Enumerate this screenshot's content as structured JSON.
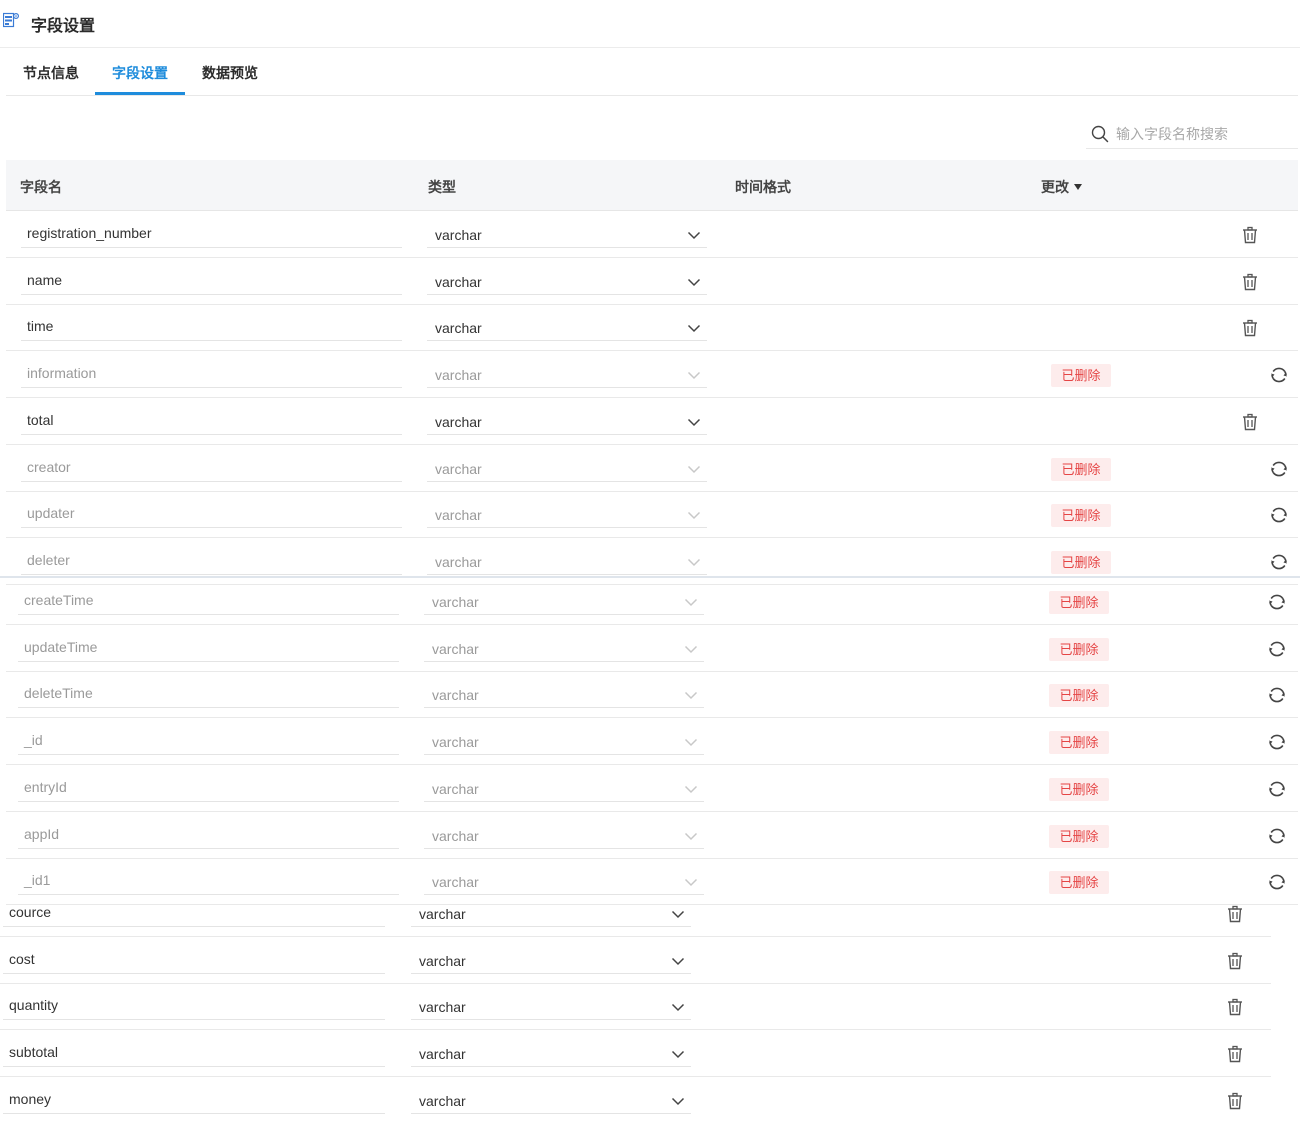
{
  "page": {
    "title": "字段设置"
  },
  "tabs": [
    {
      "label": "节点信息",
      "active": false
    },
    {
      "label": "字段设置",
      "active": true
    },
    {
      "label": "数据预览",
      "active": false
    }
  ],
  "search": {
    "placeholder": "输入字段名称搜索",
    "value": ""
  },
  "table": {
    "headers": {
      "name": "字段名",
      "type": "类型",
      "time_format": "时间格式",
      "change": "更改"
    },
    "deleted_label": "已删除",
    "rows": [
      {
        "name": "registration_number",
        "type": "varchar",
        "deleted": false
      },
      {
        "name": "name",
        "type": "varchar",
        "deleted": false
      },
      {
        "name": "time",
        "type": "varchar",
        "deleted": false
      },
      {
        "name": "information",
        "type": "varchar",
        "deleted": true
      },
      {
        "name": "total",
        "type": "varchar",
        "deleted": false
      },
      {
        "name": "creator",
        "type": "varchar",
        "deleted": true
      },
      {
        "name": "updater",
        "type": "varchar",
        "deleted": true
      },
      {
        "name": "deleter",
        "type": "varchar",
        "deleted": true
      },
      {
        "name": "createTime",
        "type": "varchar",
        "deleted": true
      },
      {
        "name": "updateTime",
        "type": "varchar",
        "deleted": true
      },
      {
        "name": "deleteTime",
        "type": "varchar",
        "deleted": true
      },
      {
        "name": "_id",
        "type": "varchar",
        "deleted": true
      },
      {
        "name": "entryId",
        "type": "varchar",
        "deleted": true
      },
      {
        "name": "appId",
        "type": "varchar",
        "deleted": true
      },
      {
        "name": "_id1",
        "type": "varchar",
        "deleted": true
      },
      {
        "name": "cource",
        "type": "varchar",
        "deleted": false
      },
      {
        "name": "cost",
        "type": "varchar",
        "deleted": false
      },
      {
        "name": "quantity",
        "type": "varchar",
        "deleted": false
      },
      {
        "name": "subtotal",
        "type": "varchar",
        "deleted": false
      },
      {
        "name": "money",
        "type": "varchar",
        "deleted": false
      }
    ]
  },
  "icons": {
    "title": "table-settings-icon",
    "search": "search-icon",
    "dropdown": "chevron-down-icon",
    "delete": "trash-icon",
    "restore": "restore-icon",
    "sort": "caret-down-icon"
  },
  "colors": {
    "accent": "#1e8cdc",
    "deleted_text": "#e54545",
    "deleted_bg": "#fdecec",
    "muted_text": "#9a9a9a"
  }
}
